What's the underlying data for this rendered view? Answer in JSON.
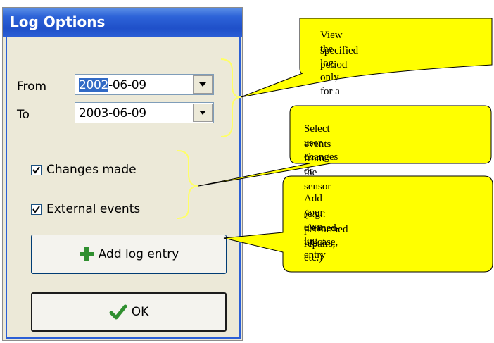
{
  "dialog": {
    "title": "Log Options",
    "from_label": "From",
    "to_label": "To",
    "from_value_selected": "2002",
    "from_value_rest": "-06-09",
    "to_value": "2003-06-09",
    "changes_made_label": "Changes made",
    "changes_made_checked": true,
    "external_events_label": "External events",
    "external_events_checked": true,
    "add_entry_label": "Add log entry",
    "ok_label": "OK"
  },
  "callouts": {
    "period_line1": "View the log only for a",
    "period_line2": "specified period",
    "events_line1": "Select user changes or",
    "events_line2": "events from the sensor",
    "entry_line1": "Add your own log entry",
    "entry_line2": "(e.g.: cleaned-up case,",
    "entry_line3": "performed repairs, etc.)"
  },
  "colors": {
    "titlebar": "#2b5fd6",
    "callout_fill": "#ffff00",
    "bracket": "#ffff66",
    "add_icon": "#2f8f2f",
    "ok_icon": "#2f8f2f"
  },
  "icons": {
    "add": "plus-icon",
    "ok": "checkmark-icon",
    "dropdown": "chevron-down-icon"
  }
}
